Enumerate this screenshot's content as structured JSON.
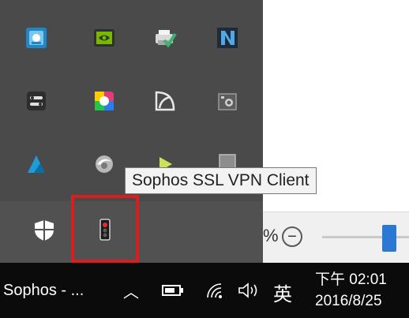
{
  "tray": {
    "icons": [
      {
        "name": "network-settings-icon"
      },
      {
        "name": "nvidia-icon"
      },
      {
        "name": "printer-check-icon"
      },
      {
        "name": "n-logo-icon"
      },
      {
        "name": "toggle-app-icon"
      },
      {
        "name": "color-wheel-icon"
      },
      {
        "name": "gauge-icon"
      },
      {
        "name": "camera-icon"
      },
      {
        "name": "autodesk-icon"
      },
      {
        "name": "swirl-icon"
      },
      {
        "name": "green-arrow-icon"
      },
      {
        "name": "grey-square-icon"
      },
      {
        "name": "windows-defender-shield-icon"
      },
      {
        "name": "sophos-traffic-light-icon"
      }
    ]
  },
  "tooltip": {
    "text": "Sophos SSL VPN Client"
  },
  "zoom": {
    "percent_suffix": "%",
    "minus_label": "−",
    "level": 0.7
  },
  "taskbar": {
    "app_label": "Sophos - ...",
    "chevron": "︿",
    "ime": "英",
    "time": "下午 02:01",
    "date": "2016/8/25"
  },
  "colors": {
    "highlight": "#d81e1e",
    "taskbar_bg": "#0b0b0b",
    "tray_bg": "#4a4a4a",
    "zoom_thumb": "#2b78d4"
  }
}
